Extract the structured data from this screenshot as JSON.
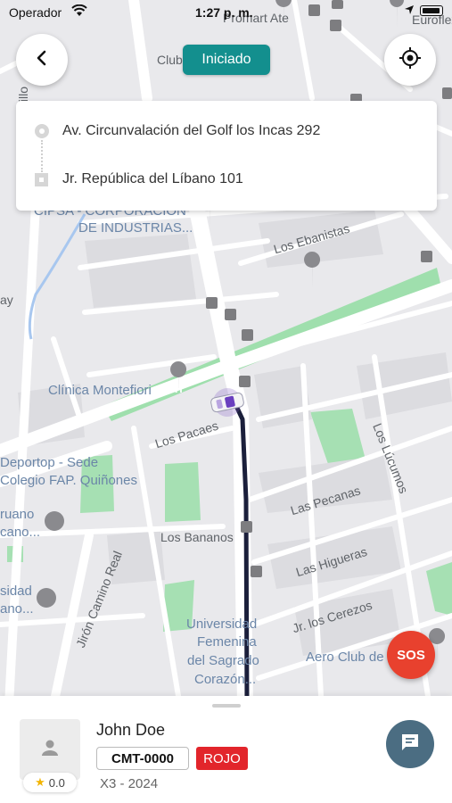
{
  "status_bar": {
    "carrier": "Operador",
    "time": "1:27 p. m."
  },
  "trip": {
    "status": "Iniciado",
    "origin": "Av. Circunvalación del Golf los Incas 292",
    "destination": "Jr. República del Líbano 101"
  },
  "map": {
    "labels": {
      "promart": "Promart Ate",
      "euroflex": "Euroflex",
      "club": "Club",
      "cipsa": "CIPSA - CORPORACIÓN",
      "cipsa2": "DE INDUSTRIAS...",
      "ebanistas": "Los Ebanistas",
      "clinica": "Clínica Montefiori",
      "pacaes": "Los Pacaes",
      "deportop": "Deportop - Sede",
      "deportop2": "Colegio FAP. Quiñones",
      "lucumos": "Los Lúcumos",
      "pecanas": "Las Pecanas",
      "bananos": "Los Bananos",
      "higueras": "Las Higueras",
      "camino_real": "Jirón Camino Real",
      "cerezos": "Jr. los Cerezos",
      "universidad": "Universidad",
      "universidad2": "Femenina",
      "universidad3": "del Sagrado",
      "universidad4": "Corazón...",
      "aero": "Aero Club de",
      "peruano": "ruano",
      "peruano2": "cano...",
      "sidad": "sidad",
      "sidad2": "ano...",
      "tillo": "tillo",
      "ay": "ay"
    }
  },
  "sos_label": "SOS",
  "driver": {
    "name": "John Doe",
    "rating": "0.0",
    "plate": "CMT-0000",
    "color": "ROJO",
    "vehicle": "X3 - 2024"
  },
  "colors": {
    "teal": "#138f8e",
    "sos": "#e8412e",
    "chat": "#4b6d82",
    "park": "#9fdfad",
    "route": "#1b1f3b"
  }
}
